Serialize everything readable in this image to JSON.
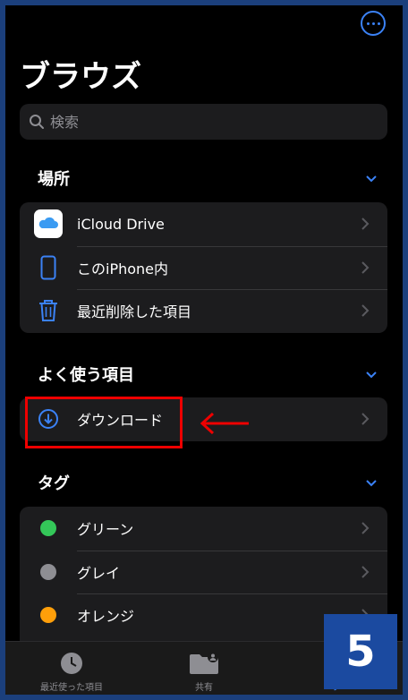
{
  "header": {
    "title": "ブラウズ",
    "more_icon": "ellipsis-circle-icon"
  },
  "search": {
    "placeholder": "検索"
  },
  "sections": {
    "locations": {
      "title": "場所",
      "items": [
        {
          "label": "iCloud Drive",
          "icon": "icloud-drive-icon"
        },
        {
          "label": "このiPhone内",
          "icon": "iphone-icon"
        },
        {
          "label": "最近削除した項目",
          "icon": "trash-icon"
        }
      ]
    },
    "favorites": {
      "title": "よく使う項目",
      "items": [
        {
          "label": "ダウンロード",
          "icon": "download-circle-icon"
        }
      ]
    },
    "tags": {
      "title": "タグ",
      "items": [
        {
          "label": "グリーン",
          "color": "#34c759"
        },
        {
          "label": "グレイ",
          "color": "#8e8e93"
        },
        {
          "label": "オレンジ",
          "color": "#ff9f0a"
        }
      ]
    }
  },
  "tabbar": {
    "tabs": [
      {
        "label": "最近使った項目",
        "icon": "clock-icon"
      },
      {
        "label": "共有",
        "icon": "shared-folder-icon"
      },
      {
        "label": "ブ",
        "icon": "folder-icon",
        "active": true
      }
    ]
  },
  "annotation": {
    "step_number": "5",
    "highlight_color": "#ee0000"
  },
  "colors": {
    "accent": "#3b82f6",
    "background": "#000000",
    "cell": "#1c1c1e"
  }
}
